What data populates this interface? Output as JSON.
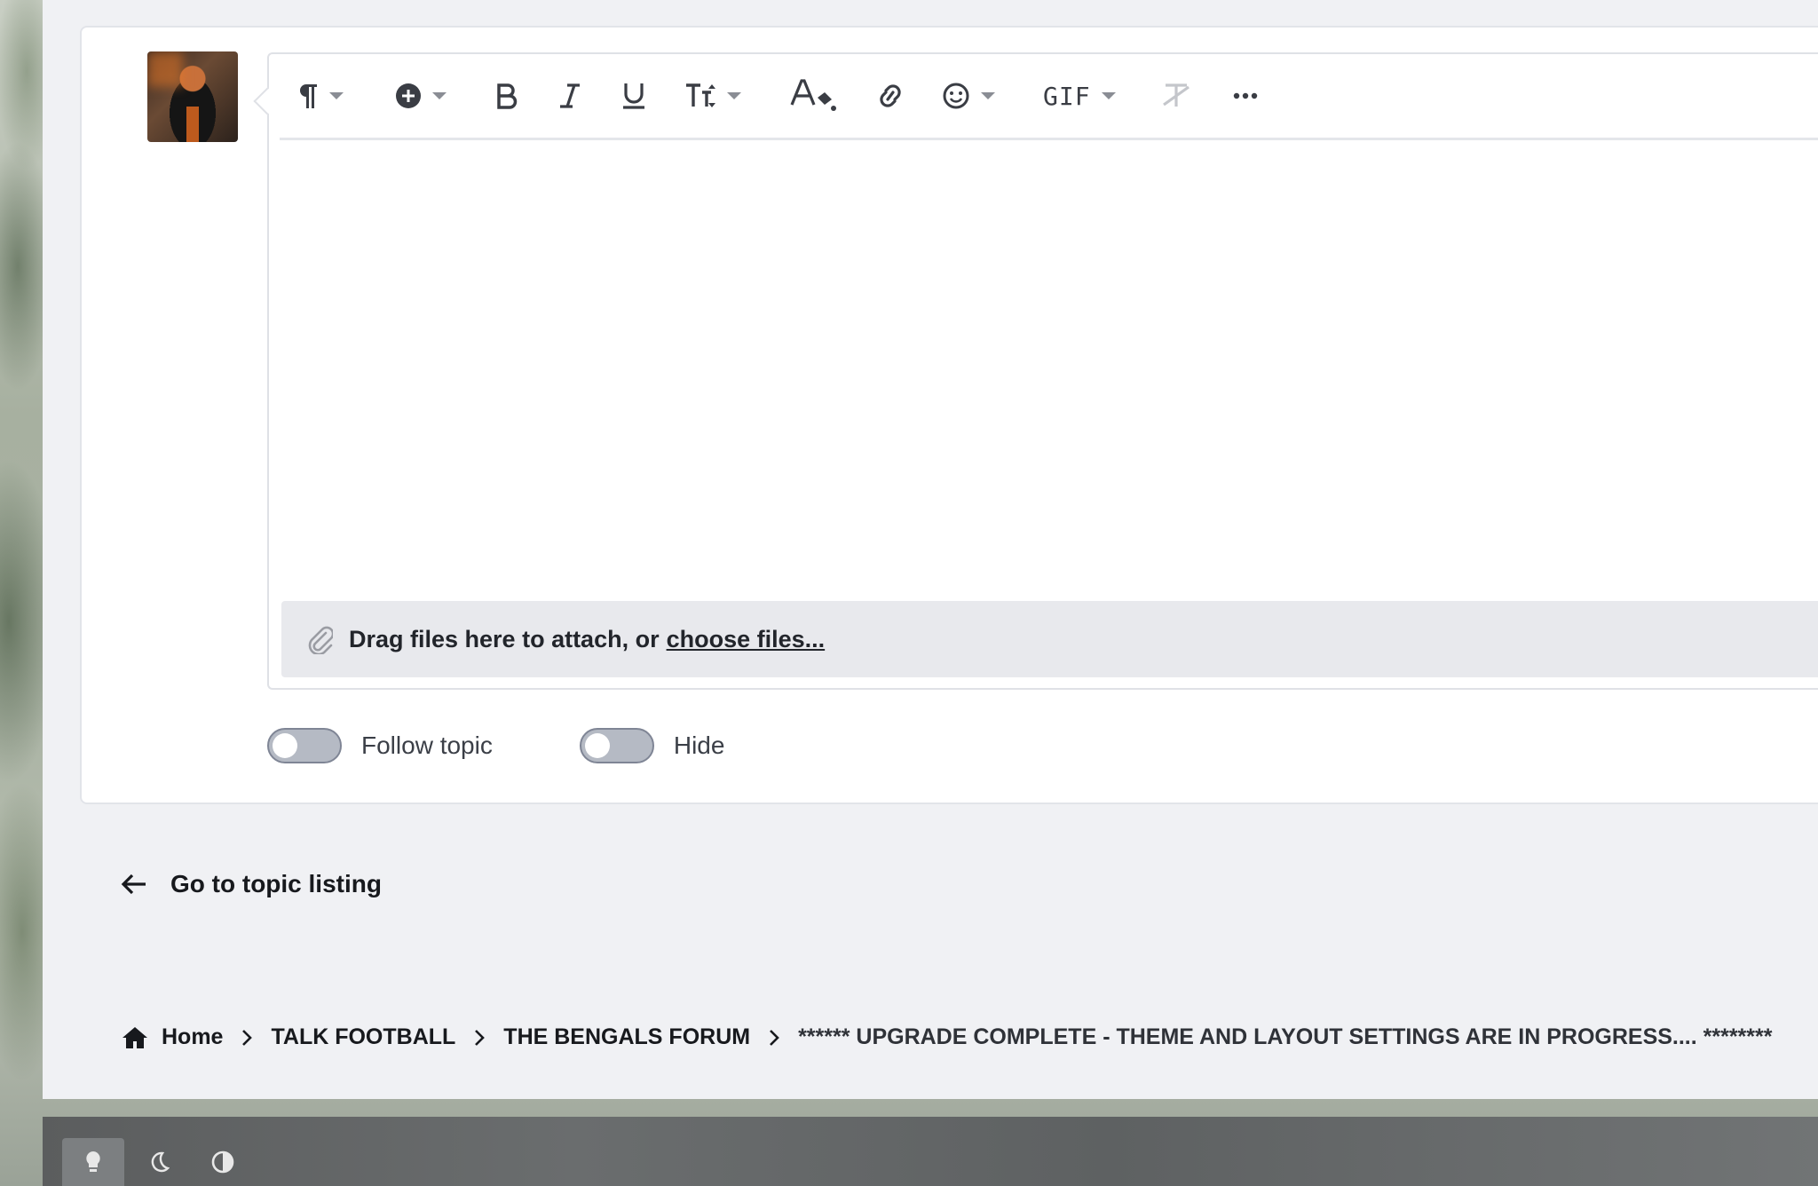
{
  "toolbar": {
    "items": [
      {
        "name": "paragraph-format-button",
        "icon": "pilcrow-icon",
        "has_caret": true
      },
      {
        "name": "insert-button",
        "icon": "plus-circle-icon",
        "has_caret": true
      },
      {
        "name": "bold-button",
        "icon": "bold-icon",
        "has_caret": false
      },
      {
        "name": "italic-button",
        "icon": "italic-icon",
        "has_caret": false
      },
      {
        "name": "underline-button",
        "icon": "underline-icon",
        "has_caret": false
      },
      {
        "name": "font-size-button",
        "icon": "text-size-icon",
        "has_caret": true
      },
      {
        "name": "text-color-button",
        "icon": "text-color-icon",
        "has_caret": false
      },
      {
        "name": "link-button",
        "icon": "link-icon",
        "has_caret": false
      },
      {
        "name": "emoji-button",
        "icon": "smiley-icon",
        "has_caret": true
      },
      {
        "name": "gif-button",
        "icon": "gif-icon",
        "has_caret": true
      },
      {
        "name": "clear-formatting-button",
        "icon": "clear-format-icon",
        "has_caret": false
      },
      {
        "name": "more-button",
        "icon": "ellipsis-icon",
        "has_caret": false
      }
    ],
    "gif_label": "GIF"
  },
  "attach": {
    "text": "Drag files here to attach, or",
    "link": "choose files..."
  },
  "toggles": {
    "follow_label": "Follow topic",
    "follow_on": false,
    "hide_label": "Hide",
    "hide_on": false
  },
  "back_link": "Go to topic listing",
  "breadcrumb": {
    "home": "Home",
    "items": [
      "TALK FOOTBALL",
      "THE BENGALS FORUM"
    ],
    "current": "****** UPGRADE COMPLETE - THEME AND LAYOUT SETTINGS ARE IN PROGRESS.... ********"
  },
  "theme_modes": [
    "light-icon",
    "moon-icon",
    "contrast-icon"
  ],
  "colors": {
    "toggle_off": "#b5bac4",
    "page_bg": "#f0f1f4",
    "card_bg": "#ffffff",
    "attach_bg": "#e8e9ed"
  }
}
